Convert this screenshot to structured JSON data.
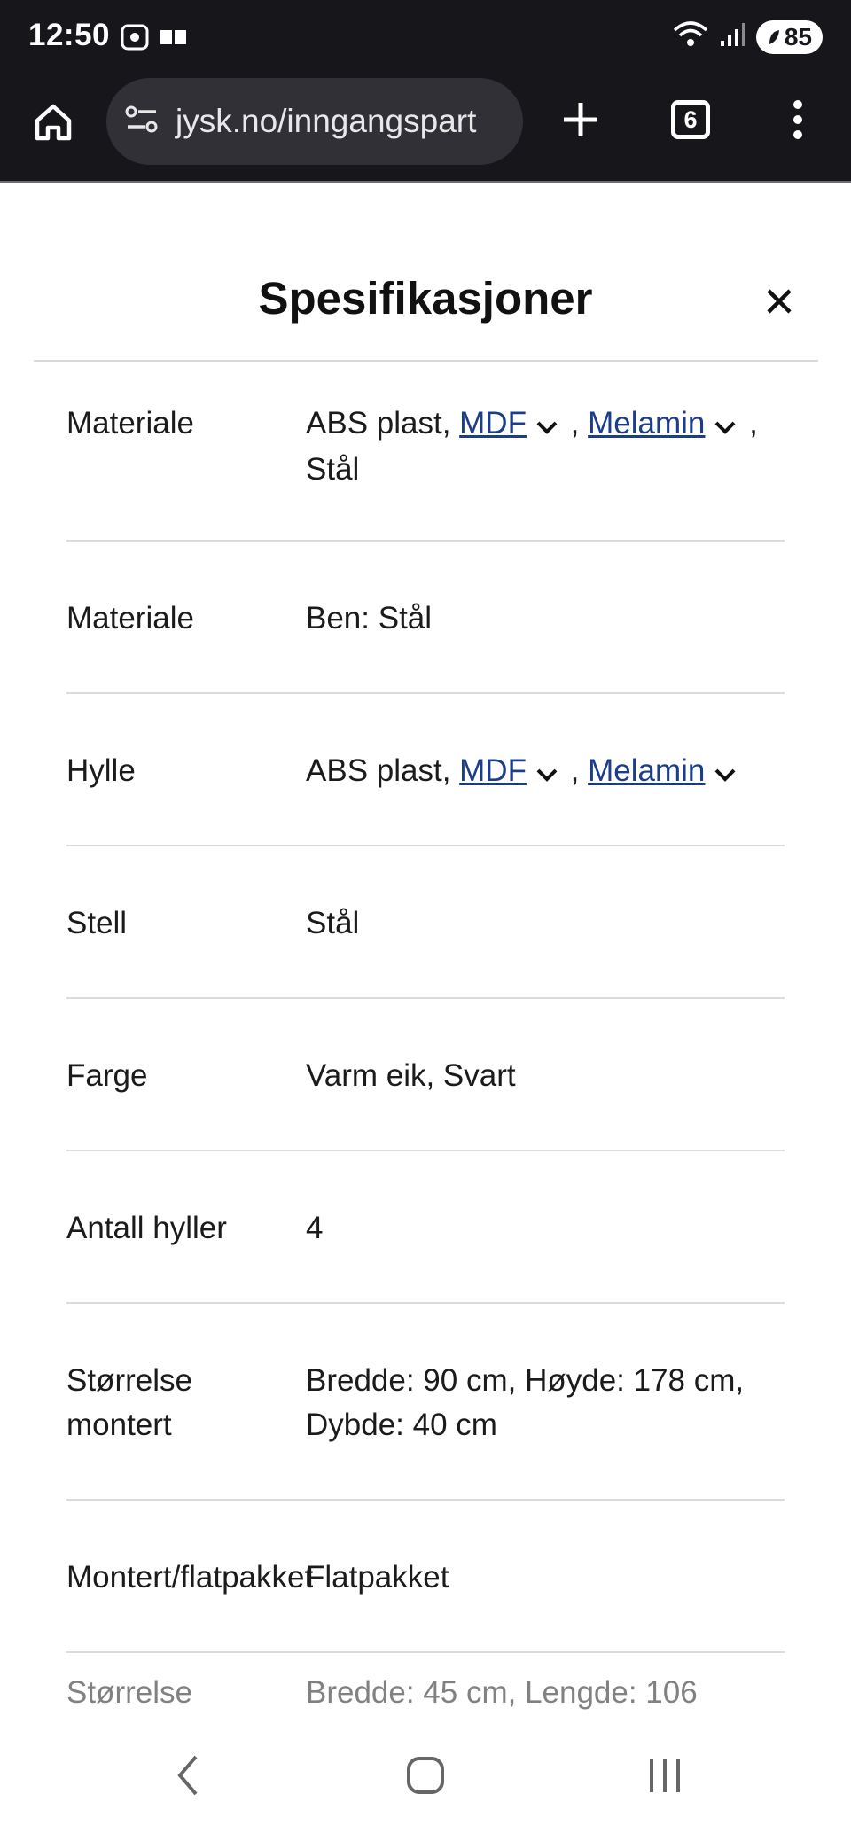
{
  "status_bar": {
    "time": "12:50",
    "battery": "85",
    "icons_left": [
      "screenshot-icon",
      "notification-icon"
    ],
    "icons_right": [
      "wifi-icon",
      "signal-icon",
      "battery-icon"
    ]
  },
  "browser": {
    "url": "jysk.no/inngangspart",
    "tab_count": "6"
  },
  "panel": {
    "title": "Spesifikasjoner",
    "rows": [
      {
        "label": "Materiale",
        "value_parts": [
          "ABS plast, ",
          "MDF",
          " , ",
          "Melamin",
          " ,",
          "Stål"
        ]
      },
      {
        "label": "Materiale",
        "value": "Ben: Stål"
      },
      {
        "label": "Hylle",
        "value_parts": [
          "ABS plast, ",
          "MDF",
          " , ",
          "Melamin"
        ]
      },
      {
        "label": "Stell",
        "value": "Stål"
      },
      {
        "label": "Farge",
        "value": "Varm eik, Svart"
      },
      {
        "label": "Antall hyller",
        "value": "4"
      },
      {
        "label_lines": [
          "Størrelse",
          "montert"
        ],
        "value_lines": [
          "Bredde: 90 cm, Høyde: 178 cm,",
          "Dybde: 40 cm"
        ]
      },
      {
        "label": "Montert/flatpakket",
        "value": "Flatpakket"
      },
      {
        "label": "Størrelse",
        "value": "Bredde: 45 cm, Lengde: 106"
      }
    ]
  }
}
